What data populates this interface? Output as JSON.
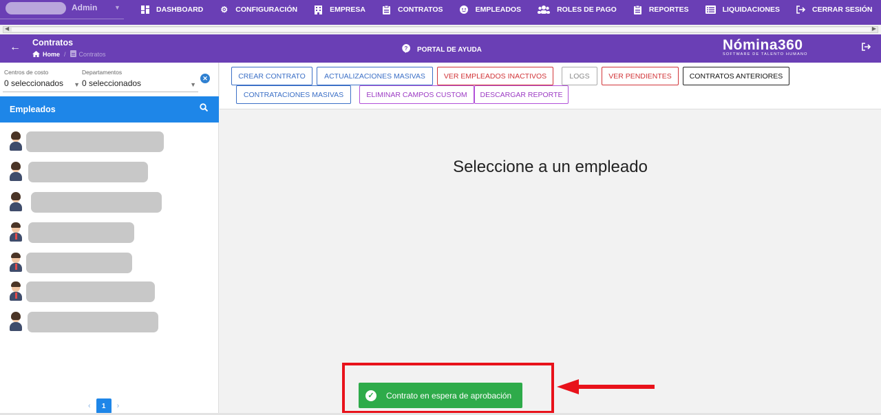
{
  "topnav": {
    "user_name": "Admin",
    "items": [
      {
        "label": "DASHBOARD",
        "icon": "dashboard-icon"
      },
      {
        "label": "CONFIGURACIÓN",
        "icon": "gear-icon"
      },
      {
        "label": "EMPRESA",
        "icon": "building-icon"
      },
      {
        "label": "CONTRATOS",
        "icon": "clipboard-icon"
      },
      {
        "label": "EMPLEADOS",
        "icon": "face-icon"
      },
      {
        "label": "ROLES DE PAGO",
        "icon": "users-icon"
      },
      {
        "label": "REPORTES",
        "icon": "clipboard-icon"
      },
      {
        "label": "LIQUIDACIONES",
        "icon": "list-icon"
      },
      {
        "label": "CERRAR SESIÓN",
        "icon": "logout-icon"
      }
    ]
  },
  "header": {
    "title": "Contratos",
    "breadcrumb_home": "Home",
    "breadcrumb_sep": "/",
    "breadcrumb_current": "Contratos",
    "help_label": "PORTAL DE AYUDA",
    "brand": "Nómina360",
    "brand_tagline": "SOFTWARE DE TALENTO HUMANO"
  },
  "filters": {
    "cost_centers_label": "Centros de costo",
    "cost_centers_value": "0 seleccionados",
    "departments_label": "Departamentos",
    "departments_value": "0 seleccionados"
  },
  "employees": {
    "title": "Empleados",
    "count_rows": 7,
    "rows": [
      {
        "avatar": "female"
      },
      {
        "avatar": "female"
      },
      {
        "avatar": "female"
      },
      {
        "avatar": "male"
      },
      {
        "avatar": "male"
      },
      {
        "avatar": "male"
      },
      {
        "avatar": "female"
      }
    ],
    "page": "1"
  },
  "toolbar": {
    "buttons": [
      {
        "label": "CREAR CONTRATO",
        "style": "blue"
      },
      {
        "label": "ACTUALIZACIONES MASIVAS",
        "style": "blue"
      },
      {
        "label": "VER EMPLEADOS INACTIVOS",
        "style": "red"
      },
      {
        "label": "LOGS",
        "style": "gray"
      },
      {
        "label": "VER PENDIENTES",
        "style": "red"
      },
      {
        "label": "CONTRATOS ANTERIORES",
        "style": "black"
      },
      {
        "label": "CONTRATACIONES MASIVAS",
        "style": "blue"
      },
      {
        "label": "ELIMINAR CAMPOS CUSTOM",
        "style": "purple"
      },
      {
        "label": "DESCARGAR REPORTE",
        "style": "purple"
      }
    ]
  },
  "main": {
    "empty_message": "Seleccione a un empleado"
  },
  "toast": {
    "message": "Contrato en espera de aprobación"
  },
  "colors": {
    "nav_bg": "#6a3fb5",
    "accent_blue": "#1e86e8",
    "success": "#2eab4a",
    "annotation_red": "#e8121b"
  }
}
